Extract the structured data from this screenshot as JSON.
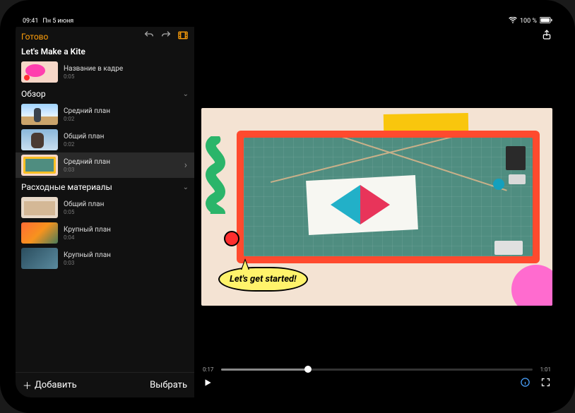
{
  "status": {
    "time": "09:41",
    "date": "Пн 5 июня",
    "battery": "100 %"
  },
  "header": {
    "done": "Готово"
  },
  "project": {
    "title": "Let's Make a Kite"
  },
  "title_clip": {
    "label": "Название в кадре",
    "duration": "0:05"
  },
  "sections": [
    {
      "title": "Обзор",
      "clips": [
        {
          "label": "Средний план",
          "duration": "0:02"
        },
        {
          "label": "Общий план",
          "duration": "0:02"
        },
        {
          "label": "Средний план",
          "duration": "0:03",
          "selected": true
        }
      ]
    },
    {
      "title": "Расходные материалы",
      "clips": [
        {
          "label": "Общий план",
          "duration": "0:05"
        },
        {
          "label": "Крупный план",
          "duration": "0:04"
        },
        {
          "label": "Крупный план",
          "duration": "0:03"
        }
      ]
    }
  ],
  "footer": {
    "add": "Добавить",
    "select": "Выбрать"
  },
  "preview": {
    "bubble_text": "Let's get started!"
  },
  "playback": {
    "current": "0:17",
    "total": "1:01",
    "progress_pct": 28
  }
}
